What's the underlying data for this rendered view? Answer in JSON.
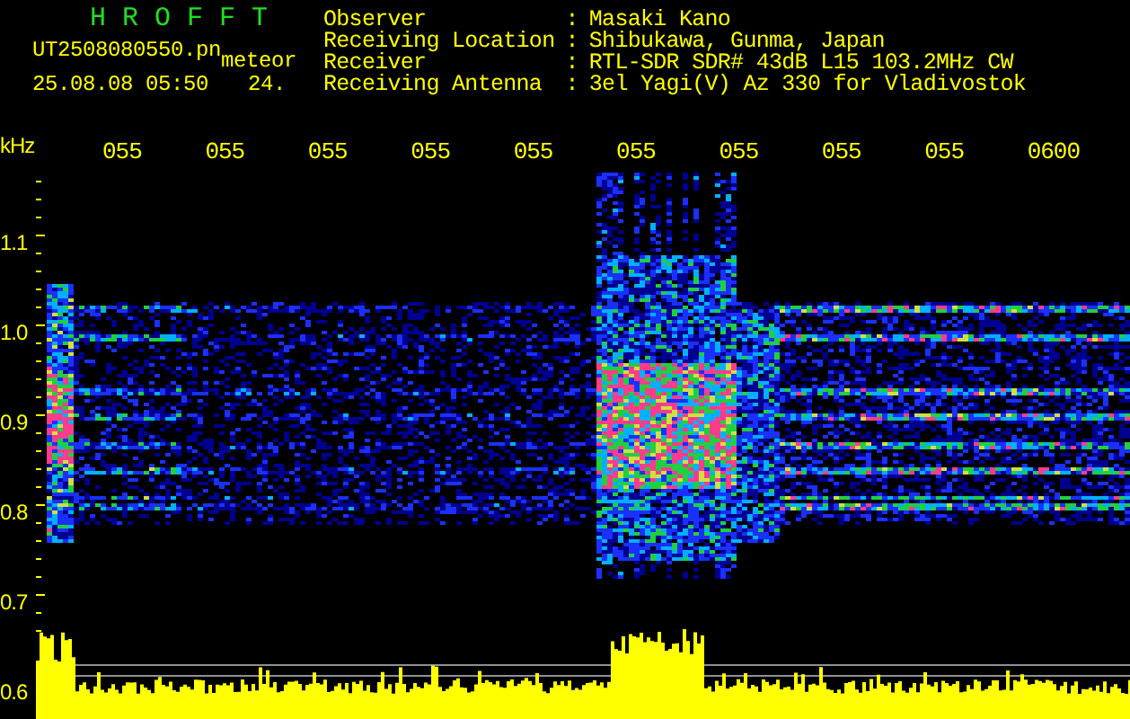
{
  "app": {
    "title": "HROFFT"
  },
  "file": {
    "name": "UT2508080550.pn",
    "tag": "meteor",
    "timestamp": "25.08.08 05:50",
    "count": "24."
  },
  "station": [
    {
      "label": "Observer",
      "separator": ":",
      "value": "Masaki Kano"
    },
    {
      "label": "Receiving Location",
      "separator": ":",
      "value": "Shibukawa, Gunma, Japan"
    },
    {
      "label": "Receiver",
      "separator": ":",
      "value": "RTL-SDR SDR# 43dB L15 103.2MHz CW"
    },
    {
      "label": "Receiving Antenna",
      "separator": ":",
      "value": "3el Yagi(V) Az 330 for Vladivostok"
    }
  ],
  "axis": {
    "unit": "kHz",
    "frequency_labels": [
      "1.1",
      "1.0",
      "0.9",
      "0.8",
      "0.7",
      "0.6"
    ],
    "time_labels": [
      "055",
      "055",
      "055",
      "055",
      "055",
      "055",
      "055",
      "055",
      "055",
      "0600"
    ]
  }
}
